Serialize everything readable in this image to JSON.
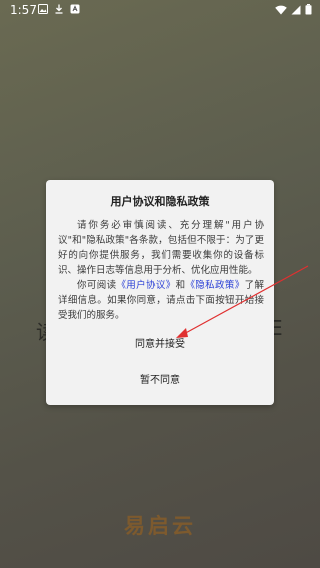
{
  "status_bar": {
    "time": "1:57"
  },
  "background": {
    "left_char": "读",
    "right_char": "E",
    "brand": "易启云"
  },
  "dialog": {
    "title": "用户协议和隐私政策",
    "paragraph1": "请你务必审慎阅读、充分理解\"用户协议\"和\"隐私政策\"各条款，包括但不限于：为了更好的向你提供服务，我们需要收集你的设备标识、操作日志等信息用于分析、优化应用性能。",
    "paragraph2_prefix": "你可阅读",
    "user_agreement_link": "《用户协议》",
    "paragraph2_and": "和",
    "privacy_policy_link": "《隐私政策》",
    "paragraph2_suffix": "了解详细信息。如果你同意，请点击下面按钮开始接受我们的服务。",
    "agree_label": "同意并接受",
    "decline_label": "暂不同意"
  },
  "colors": {
    "link": "#2a3fd6",
    "arrow": "#e03030",
    "brand": "#7d5a2e"
  }
}
